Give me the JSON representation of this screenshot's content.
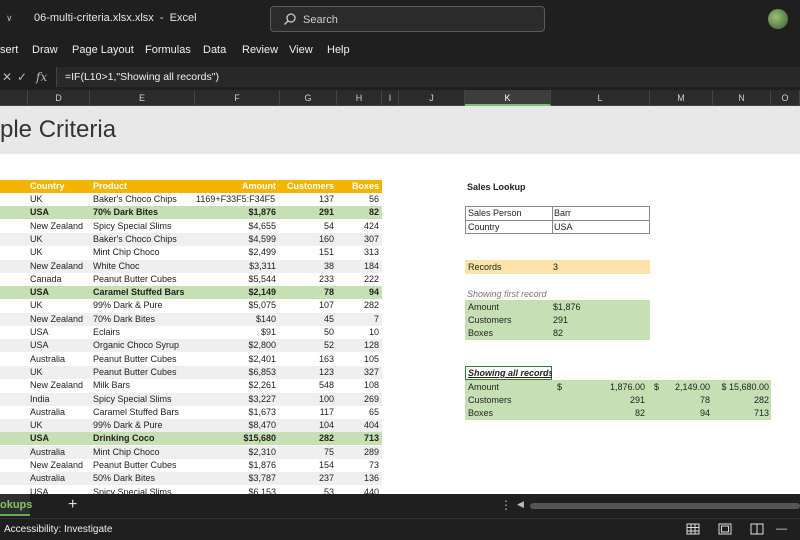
{
  "window": {
    "title": "06-multi-criteria.xlsx.xlsx  -  Excel",
    "search_placeholder": "Search"
  },
  "menu": [
    "sert",
    "Draw",
    "Page Layout",
    "Formulas",
    "Data",
    "Review",
    "View",
    "Help"
  ],
  "formula_bar": {
    "fx": "fx",
    "formula": "=IF(L10>1,\"Showing all records\")"
  },
  "columns": [
    {
      "label": "D"
    },
    {
      "label": "E"
    },
    {
      "label": "F"
    },
    {
      "label": "G"
    },
    {
      "label": "H"
    },
    {
      "label": "I"
    },
    {
      "label": "J"
    },
    {
      "label": "K"
    },
    {
      "label": "L"
    },
    {
      "label": "M"
    },
    {
      "label": "N"
    },
    {
      "label": "O"
    }
  ],
  "sheet_title": "ple Criteria",
  "table": {
    "headers": [
      "Country",
      "Product",
      "Amount",
      "Customers",
      "Boxes"
    ],
    "rows": [
      {
        "country": "UK",
        "product": "Baker's Choco Chips",
        "amount": "1169+F33F5:F34F5:",
        "customers": "137",
        "boxes": "56",
        "hl": false
      },
      {
        "country": "USA",
        "product": "70% Dark Bites",
        "amount": "$1,876",
        "customers": "291",
        "boxes": "82",
        "hl": true
      },
      {
        "country": "New Zealand",
        "product": "Spicy Special Slims",
        "amount": "$4,655",
        "customers": "54",
        "boxes": "424",
        "hl": false
      },
      {
        "country": "UK",
        "product": "Baker's Choco Chips",
        "amount": "$4,599",
        "customers": "160",
        "boxes": "307",
        "hl": false
      },
      {
        "country": "UK",
        "product": "Mint Chip Choco",
        "amount": "$2,499",
        "customers": "151",
        "boxes": "313",
        "hl": false
      },
      {
        "country": "New Zealand",
        "product": "White Choc",
        "amount": "$3,311",
        "customers": "38",
        "boxes": "184",
        "hl": false
      },
      {
        "country": "Canada",
        "product": "Peanut Butter Cubes",
        "amount": "$5,544",
        "customers": "233",
        "boxes": "222",
        "hl": false
      },
      {
        "country": "USA",
        "product": "Caramel Stuffed Bars",
        "amount": "$2,149",
        "customers": "78",
        "boxes": "94",
        "hl": true
      },
      {
        "country": "UK",
        "product": "99% Dark & Pure",
        "amount": "$5,075",
        "customers": "107",
        "boxes": "282",
        "hl": false
      },
      {
        "country": "New Zealand",
        "product": "70% Dark Bites",
        "amount": "$140",
        "customers": "45",
        "boxes": "7",
        "hl": false
      },
      {
        "country": "USA",
        "product": "Eclairs",
        "amount": "$91",
        "customers": "50",
        "boxes": "10",
        "hl": false
      },
      {
        "country": "USA",
        "product": "Organic Choco Syrup",
        "amount": "$2,800",
        "customers": "52",
        "boxes": "128",
        "hl": false
      },
      {
        "country": "Australia",
        "product": "Peanut Butter Cubes",
        "amount": "$2,401",
        "customers": "163",
        "boxes": "105",
        "hl": false
      },
      {
        "country": "UK",
        "product": "Peanut Butter Cubes",
        "amount": "$6,853",
        "customers": "123",
        "boxes": "327",
        "hl": false
      },
      {
        "country": "New Zealand",
        "product": "Milk Bars",
        "amount": "$2,261",
        "customers": "548",
        "boxes": "108",
        "hl": false
      },
      {
        "country": "India",
        "product": "Spicy Special Slims",
        "amount": "$3,227",
        "customers": "100",
        "boxes": "269",
        "hl": false
      },
      {
        "country": "Australia",
        "product": "Caramel Stuffed Bars",
        "amount": "$1,673",
        "customers": "117",
        "boxes": "65",
        "hl": false
      },
      {
        "country": "UK",
        "product": "99% Dark & Pure",
        "amount": "$8,470",
        "customers": "104",
        "boxes": "404",
        "hl": false
      },
      {
        "country": "USA",
        "product": "Drinking Coco",
        "amount": "$15,680",
        "customers": "282",
        "boxes": "713",
        "hl": true
      },
      {
        "country": "Australia",
        "product": "Mint Chip Choco",
        "amount": "$2,310",
        "customers": "75",
        "boxes": "289",
        "hl": false
      },
      {
        "country": "New Zealand",
        "product": "Peanut Butter Cubes",
        "amount": "$1,876",
        "customers": "154",
        "boxes": "73",
        "hl": false
      },
      {
        "country": "Australia",
        "product": "50% Dark Bites",
        "amount": "$3,787",
        "customers": "237",
        "boxes": "136",
        "hl": false
      },
      {
        "country": "USA",
        "product": "Spicy Special Slims",
        "amount": "$6,153",
        "customers": "53",
        "boxes": "440",
        "hl": false
      }
    ]
  },
  "lookup": {
    "title": "Sales Lookup",
    "criteria": [
      {
        "label": "Sales Person",
        "value": "Barr"
      },
      {
        "label": "Country",
        "value": "USA"
      }
    ],
    "records_label": "Records",
    "records_value": "3",
    "first_caption": "Showing first record",
    "first": [
      {
        "label": "Amount",
        "value": "$1,876"
      },
      {
        "label": "Customers",
        "value": "291"
      },
      {
        "label": "Boxes",
        "value": "82"
      }
    ],
    "all_caption": "Showing all records",
    "all": [
      {
        "label": "Amount",
        "c1": "$",
        "v1": "1,876.00",
        "c2": "$",
        "v2": "2,149.00",
        "v3": "$ 15,680.00"
      },
      {
        "label": "Customers",
        "c1": "",
        "v1": "291",
        "c2": "",
        "v2": "78",
        "v3": "282"
      },
      {
        "label": "Boxes",
        "c1": "",
        "v1": "82",
        "c2": "",
        "v2": "94",
        "v3": "713"
      }
    ]
  },
  "tabs": {
    "active": "okups",
    "add": "+"
  },
  "status": {
    "text": "Accessibility: Investigate"
  },
  "colors": {
    "header": "#f4b400",
    "highlight": "#c6e0b4",
    "records": "#fce4a8",
    "accent": "#5fb14a"
  }
}
